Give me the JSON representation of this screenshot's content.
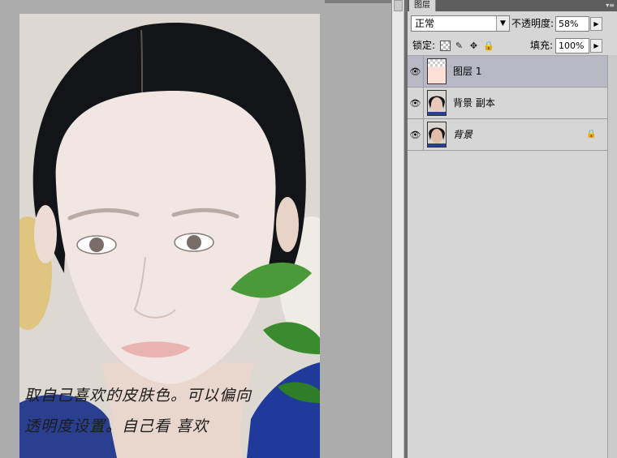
{
  "canvas": {
    "caption_line1": "取自己喜欢的皮肤色。可以偏向",
    "caption_line2": "透明度设置。自己看 喜欢"
  },
  "panel": {
    "tab_label": "图层",
    "menu_icon": "panel-menu-icon",
    "blend_mode": "正常",
    "opacity_label": "不透明度:",
    "opacity_value": "58%",
    "lock_label": "锁定:",
    "fill_label": "填充:",
    "fill_value": "100%",
    "lock_icons": [
      "lock-transparent-icon",
      "brush-icon",
      "move-icon",
      "padlock-icon"
    ]
  },
  "layers": [
    {
      "name": "图层 1",
      "selected": true,
      "visible": true,
      "thumb": "skin-color",
      "locked": false
    },
    {
      "name": "背景 副本",
      "selected": false,
      "visible": true,
      "thumb": "portrait",
      "locked": false
    },
    {
      "name": "背景",
      "selected": false,
      "visible": true,
      "thumb": "portrait",
      "locked": true
    }
  ],
  "colors": {
    "skin_fill": "#fce0d6",
    "selected_layer": "#b7b8c3",
    "panel_bg": "#d6d6d6"
  }
}
